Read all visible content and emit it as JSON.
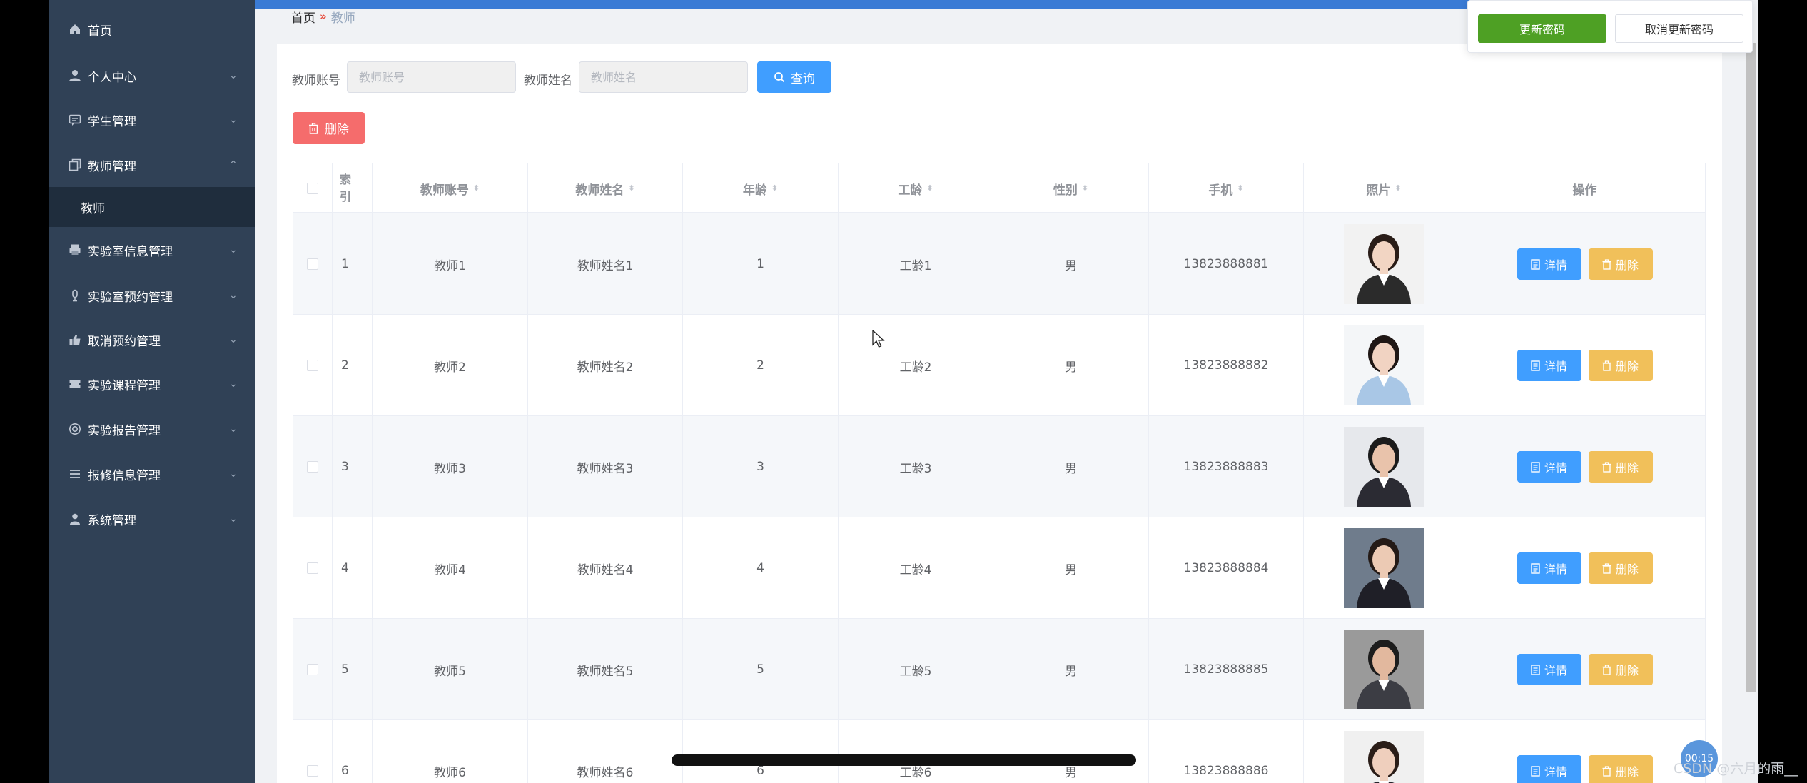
{
  "sidebar": {
    "items": [
      {
        "label": "首页",
        "icon": "home-icon"
      },
      {
        "label": "个人中心",
        "icon": "user-icon"
      },
      {
        "label": "学生管理",
        "icon": "chat-icon"
      },
      {
        "label": "教师管理",
        "icon": "copy-icon",
        "expanded": true
      },
      {
        "label": "实验室信息管理",
        "icon": "printer-icon"
      },
      {
        "label": "实验室预约管理",
        "icon": "microphone-icon"
      },
      {
        "label": "取消预约管理",
        "icon": "thumb-icon"
      },
      {
        "label": "实验课程管理",
        "icon": "ticket-icon"
      },
      {
        "label": "实验报告管理",
        "icon": "circle-icon"
      },
      {
        "label": "报修信息管理",
        "icon": "list-icon"
      },
      {
        "label": "系统管理",
        "icon": "person-icon"
      }
    ],
    "submenu_label": "教师"
  },
  "breadcrumb": {
    "home": "首页",
    "current": "教师"
  },
  "search": {
    "account_label": "教师账号",
    "account_placeholder": "教师账号",
    "name_label": "教师姓名",
    "name_placeholder": "教师姓名",
    "button_label": "查询"
  },
  "toolbar": {
    "delete_label": "删除"
  },
  "table": {
    "headers": {
      "index": "索引",
      "account": "教师账号",
      "name": "教师姓名",
      "age": "年龄",
      "seniority": "工龄",
      "gender": "性别",
      "phone": "手机",
      "photo": "照片",
      "action": "操作"
    },
    "detail_label": "详情",
    "delete_label": "删除",
    "rows": [
      {
        "index": "1",
        "account": "教师1",
        "name": "教师姓名1",
        "age": "1",
        "seniority": "工龄1",
        "gender": "男",
        "phone": "13823888881"
      },
      {
        "index": "2",
        "account": "教师2",
        "name": "教师姓名2",
        "age": "2",
        "seniority": "工龄2",
        "gender": "男",
        "phone": "13823888882"
      },
      {
        "index": "3",
        "account": "教师3",
        "name": "教师姓名3",
        "age": "3",
        "seniority": "工龄3",
        "gender": "男",
        "phone": "13823888883"
      },
      {
        "index": "4",
        "account": "教师4",
        "name": "教师姓名4",
        "age": "4",
        "seniority": "工龄4",
        "gender": "男",
        "phone": "13823888884"
      },
      {
        "index": "5",
        "account": "教师5",
        "name": "教师姓名5",
        "age": "5",
        "seniority": "工龄5",
        "gender": "男",
        "phone": "13823888885"
      },
      {
        "index": "6",
        "account": "教师6",
        "name": "教师姓名6",
        "age": "6",
        "seniority": "工龄6",
        "gender": "男",
        "phone": "13823888886"
      }
    ]
  },
  "password_popover": {
    "update_label": "更新密码",
    "cancel_label": "取消更新密码"
  },
  "overlay": {
    "timer": "00:15",
    "watermark": "CSDN @六月的雨__"
  },
  "colors": {
    "sidebar": "#304156",
    "primary": "#409eff",
    "danger": "#f56c6c",
    "warning": "#f1c05a",
    "success": "#4ea024"
  }
}
